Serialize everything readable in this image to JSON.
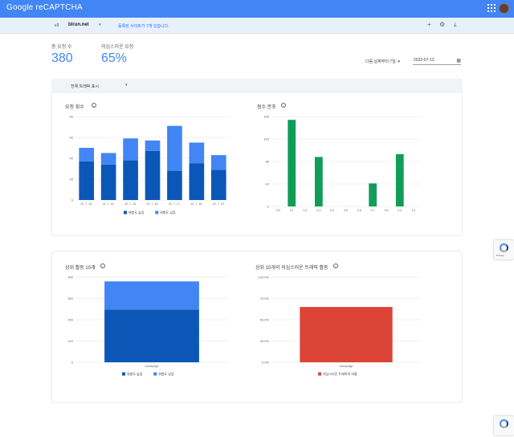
{
  "app": {
    "title": "Google reCAPTCHA"
  },
  "subbar": {
    "version": "v3",
    "site": "blrun.net",
    "notice": "등록된 사이트가 7개 있습니다."
  },
  "stats": [
    {
      "label": "총 요청 수",
      "value": "380"
    },
    {
      "label": "의심스러운 요청",
      "value": "65%"
    }
  ],
  "date_filter": {
    "label": "다음 날짜부터 7일:",
    "value": "2022-07-13"
  },
  "traffic_filter": {
    "selected": "전체 트래픽 표시"
  },
  "colors": {
    "accent": "#4285f4",
    "low_score": "#0b57b7",
    "high_score": "#4285f4",
    "distribution": "#0f9d58",
    "suspicious": "#db4437"
  },
  "icons": [
    "apps-icon",
    "avatar",
    "caret-down-icon",
    "add-icon",
    "gear-icon",
    "download-icon",
    "calendar-icon",
    "info-icon",
    "recaptcha-badge"
  ],
  "charts": {
    "requests": {
      "title": "요청 횟수"
    },
    "distribution": {
      "title": "점수 분포"
    },
    "top_actions": {
      "title": "상위 활동 10개"
    },
    "suspicious": {
      "title": "상위 10개의 의심스러운 트래픽 활동"
    }
  },
  "chart_data": [
    {
      "type": "bar",
      "title": "요청 횟수",
      "categories": [
        "22. 7. 13.",
        "22. 7. 14.",
        "22. 7. 15.",
        "22. 7. 16.",
        "22. 7. 17.",
        "22. 7. 18.",
        "22. 7. 19."
      ],
      "stacked": true,
      "series": [
        {
          "name": "위험도 높음",
          "values": [
            37,
            34,
            38,
            47,
            28,
            35,
            29
          ]
        },
        {
          "name": "위험도 낮음",
          "values": [
            13,
            11,
            21,
            10,
            43,
            20,
            14
          ]
        }
      ],
      "ylim": [
        0,
        80
      ],
      "yticks": [
        0,
        20,
        40,
        60,
        80
      ],
      "grid": true,
      "legend": "bottom"
    },
    {
      "type": "bar",
      "title": "점수 분포",
      "categories": [
        "0.0",
        "0.1",
        "0.2",
        "0.3",
        "0.4",
        "0.5",
        "0.6",
        "0.7",
        "0.8",
        "0.9",
        "1.0"
      ],
      "values": [
        0,
        154,
        0,
        88,
        0,
        0,
        0,
        41,
        0,
        93,
        0
      ],
      "ylim": [
        0,
        160
      ],
      "yticks": [
        0,
        40,
        80,
        120,
        160
      ],
      "grid": true
    },
    {
      "type": "bar",
      "title": "상위 활동 10개",
      "categories": [
        "homepage"
      ],
      "stacked": true,
      "series": [
        {
          "name": "위험도 높음",
          "values": [
            248
          ]
        },
        {
          "name": "위험도 낮음",
          "values": [
            132
          ]
        }
      ],
      "ylim": [
        0,
        400
      ],
      "yticks": [
        0,
        100,
        200,
        300,
        400
      ],
      "grid": true,
      "legend": "bottom"
    },
    {
      "type": "bar",
      "title": "상위 10개의 의심스러운 트래픽 활동",
      "categories": [
        "homepage"
      ],
      "series": [
        {
          "name": "의심스러운 트래픽의 비율",
          "values": [
            65
          ]
        }
      ],
      "ylim": [
        0,
        100
      ],
      "yticks": [
        "0.0%",
        "25.0%",
        "50.0%",
        "75.0%",
        "100.0%"
      ],
      "grid": true,
      "legend": "bottom"
    }
  ]
}
